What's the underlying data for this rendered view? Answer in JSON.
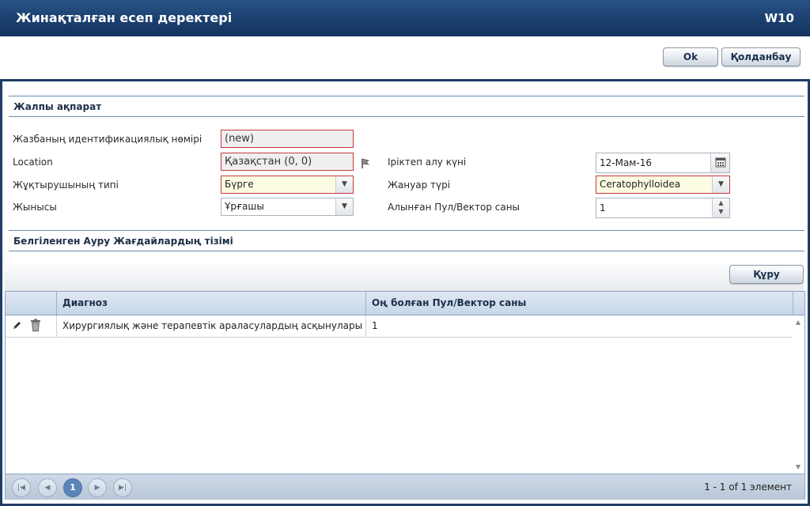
{
  "window": {
    "title": "Жинақталған есеп деректері",
    "code": "W10"
  },
  "top_buttons": {
    "ok": "Ok",
    "apply": "Қолданбау"
  },
  "sections": {
    "general": "Жалпы ақпарат",
    "diseases": "Белгіленген Ауру Жағдайлардың тізімі"
  },
  "form": {
    "id_label": "Жазбаның идентификациялық нөмірі",
    "id_value": "(new)",
    "location_label": "Location",
    "location_value": "Қазақстан (0, 0)",
    "vector_type_label": "Жұқтырушының типі",
    "vector_type_value": "Бүрге",
    "sex_label": "Жынысы",
    "sex_value": "Ұрғашы",
    "collection_date_label": "Іріктеп алу күні",
    "collection_date_value": "12-Мам-16",
    "species_label": "Жануар түрі",
    "species_value": "Ceratophylloidea",
    "pool_count_label": "Алынған Пул/Вектор саны",
    "pool_count_value": "1"
  },
  "grid": {
    "create_button": "Құру",
    "columns": [
      "Диагноз",
      "Оң болған Пул/Вектор саны"
    ],
    "rows": [
      {
        "diagnosis": "Хирургиялық және терапевтік араласулардың асқынулары",
        "positive": "1"
      }
    ],
    "pager": {
      "current_page": "1",
      "info": "1 - 1 of 1 элемент"
    }
  },
  "colors": {
    "header": "#1a3f6e",
    "required_border": "#c9383e",
    "required_bg": "#fcfce2"
  }
}
